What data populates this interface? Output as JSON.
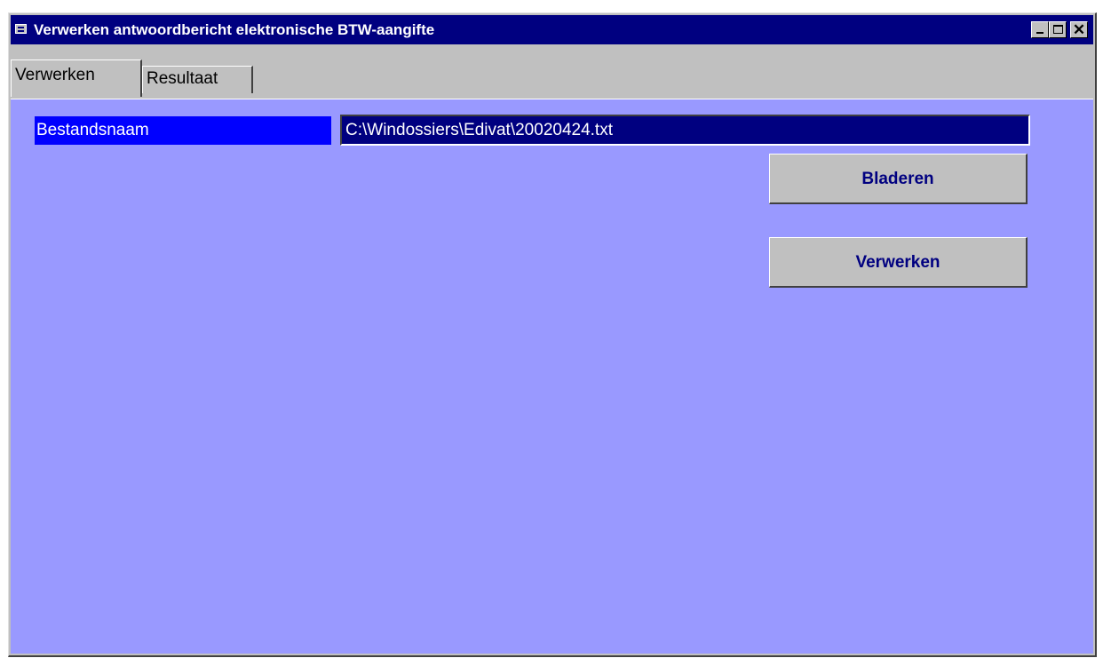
{
  "window": {
    "title": "Verwerken antwoordbericht elektronische BTW-aangifte",
    "close_glyph": "✕"
  },
  "tabs": [
    {
      "label": "Verwerken",
      "active": true
    },
    {
      "label": "Resultaat",
      "active": false
    }
  ],
  "form": {
    "filename_label": "Bestandsnaam",
    "filename_value": "C:\\Windossiers\\Edivat\\20020424.txt",
    "browse_label": "Bladeren",
    "process_label": "Verwerken"
  },
  "colors": {
    "titlebar": "#000080",
    "panel": "#9999ff",
    "label_bg": "#0000ff",
    "input_bg": "#000080",
    "button_text": "#000080"
  },
  "icons": [
    "form-app-icon",
    "minimize-icon",
    "maximize-icon",
    "close-icon"
  ]
}
